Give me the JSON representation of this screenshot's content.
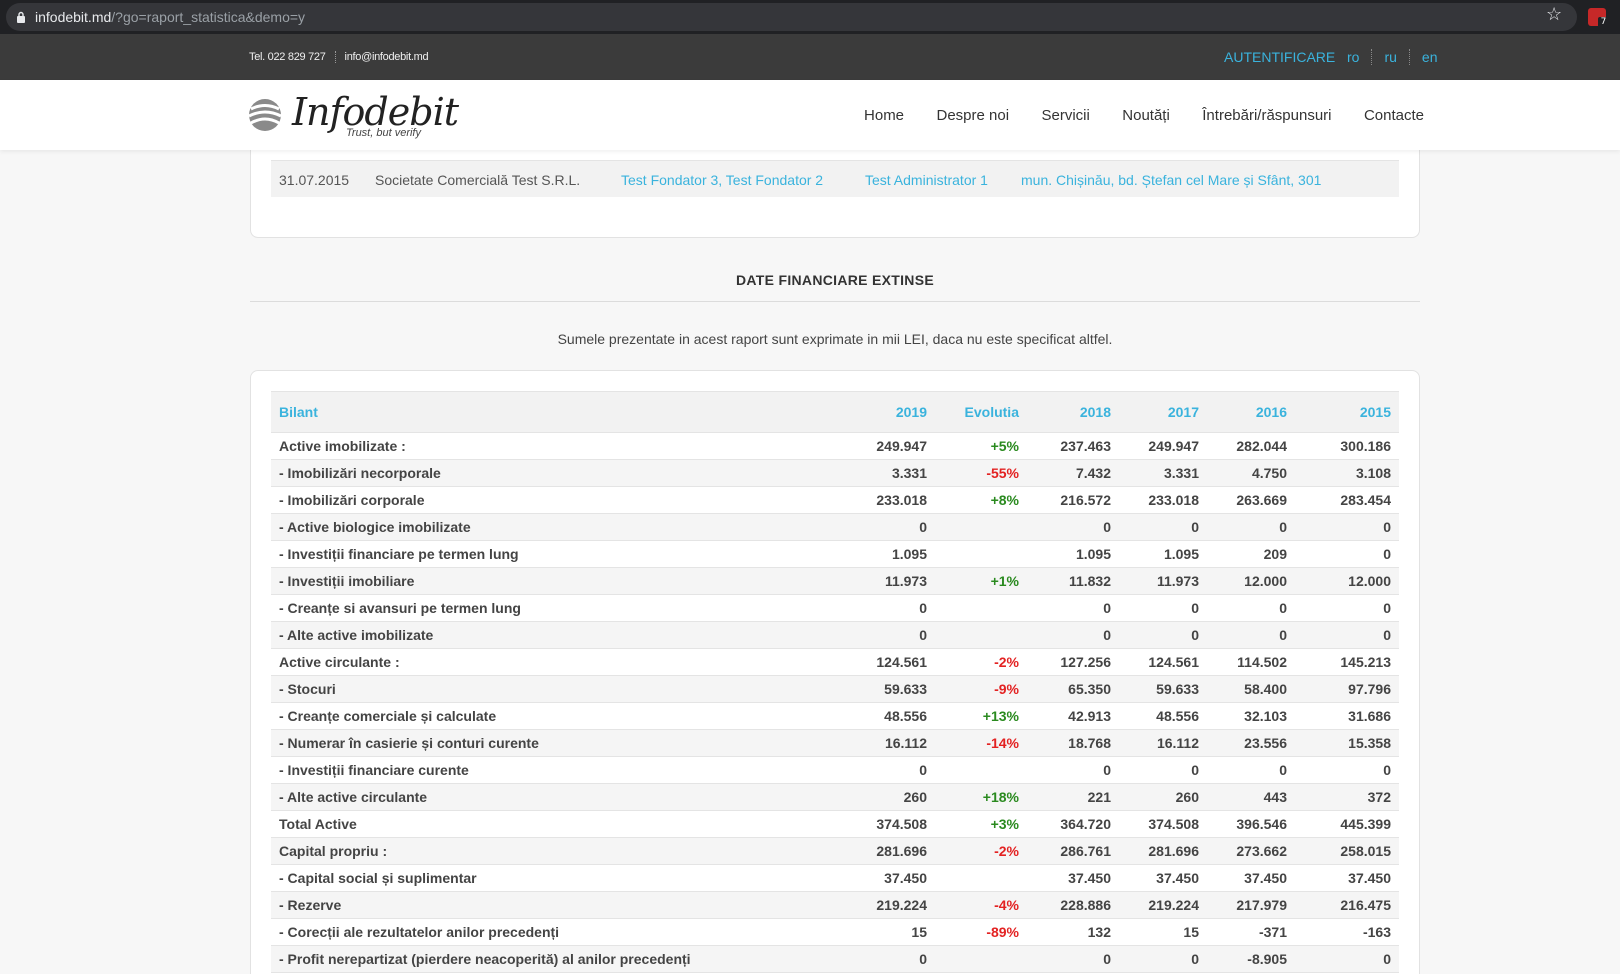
{
  "browser": {
    "url_host": "infodebit.md",
    "url_path": "/?go=raport_statistica&demo=y",
    "ext_badge": "7"
  },
  "topbar": {
    "phone": "Tel. 022 829 727",
    "email": "info@infodebit.md",
    "auth_label": "AUTENTIFICARE",
    "languages": [
      "ro",
      "ru",
      "en"
    ]
  },
  "brand": {
    "name": "Infodebit",
    "tagline": "Trust, but verify"
  },
  "nav": [
    "Home",
    "Despre noi",
    "Servicii",
    "Noutăți",
    "Întrebări/răspunsuri",
    "Contacte"
  ],
  "history_row": {
    "date": "31.07.2015",
    "company": "Societate Comercială Test S.R.L.",
    "founders": "Test Fondator 3, Test Fondator 2",
    "admin": "Test Administrator 1",
    "address": "mun. Chișinău, bd. Ștefan cel Mare și Sfânt, 301"
  },
  "section": {
    "title": "DATE FINANCIARE EXTINSE",
    "note": "Sumele prezentate in acest raport sunt exprimate in mii LEI, daca nu este specificat altfel."
  },
  "table": {
    "headers": [
      "Bilant",
      "2019",
      "Evolutia",
      "2018",
      "2017",
      "2016",
      "2015"
    ],
    "rows": [
      {
        "label": "Active imobilizate :",
        "v2019": "249.947",
        "evo": "+5%",
        "trend": "pos",
        "v2018": "237.463",
        "v2017": "249.947",
        "v2016": "282.044",
        "v2015": "300.186"
      },
      {
        "label": "- Imobilizări necorporale",
        "v2019": "3.331",
        "evo": "-55%",
        "trend": "neg",
        "v2018": "7.432",
        "v2017": "3.331",
        "v2016": "4.750",
        "v2015": "3.108"
      },
      {
        "label": "- Imobilizări corporale",
        "v2019": "233.018",
        "evo": "+8%",
        "trend": "pos",
        "v2018": "216.572",
        "v2017": "233.018",
        "v2016": "263.669",
        "v2015": "283.454"
      },
      {
        "label": "- Active biologice imobilizate",
        "v2019": "0",
        "evo": "",
        "trend": "",
        "v2018": "0",
        "v2017": "0",
        "v2016": "0",
        "v2015": "0"
      },
      {
        "label": "- Investiții financiare pe termen lung",
        "v2019": "1.095",
        "evo": "",
        "trend": "",
        "v2018": "1.095",
        "v2017": "1.095",
        "v2016": "209",
        "v2015": "0"
      },
      {
        "label": "- Investiții imobiliare",
        "v2019": "11.973",
        "evo": "+1%",
        "trend": "pos",
        "v2018": "11.832",
        "v2017": "11.973",
        "v2016": "12.000",
        "v2015": "12.000"
      },
      {
        "label": "- Creanțe si avansuri pe termen lung",
        "v2019": "0",
        "evo": "",
        "trend": "",
        "v2018": "0",
        "v2017": "0",
        "v2016": "0",
        "v2015": "0"
      },
      {
        "label": "- Alte active imobilizate",
        "v2019": "0",
        "evo": "",
        "trend": "",
        "v2018": "0",
        "v2017": "0",
        "v2016": "0",
        "v2015": "0"
      },
      {
        "label": "Active circulante :",
        "v2019": "124.561",
        "evo": "-2%",
        "trend": "neg",
        "v2018": "127.256",
        "v2017": "124.561",
        "v2016": "114.502",
        "v2015": "145.213"
      },
      {
        "label": "- Stocuri",
        "v2019": "59.633",
        "evo": "-9%",
        "trend": "neg",
        "v2018": "65.350",
        "v2017": "59.633",
        "v2016": "58.400",
        "v2015": "97.796"
      },
      {
        "label": "- Creanțe comerciale și calculate",
        "v2019": "48.556",
        "evo": "+13%",
        "trend": "pos",
        "v2018": "42.913",
        "v2017": "48.556",
        "v2016": "32.103",
        "v2015": "31.686"
      },
      {
        "label": "- Numerar în casierie și conturi curente",
        "v2019": "16.112",
        "evo": "-14%",
        "trend": "neg",
        "v2018": "18.768",
        "v2017": "16.112",
        "v2016": "23.556",
        "v2015": "15.358"
      },
      {
        "label": "- Investiții financiare curente",
        "v2019": "0",
        "evo": "",
        "trend": "",
        "v2018": "0",
        "v2017": "0",
        "v2016": "0",
        "v2015": "0"
      },
      {
        "label": "- Alte active circulante",
        "v2019": "260",
        "evo": "+18%",
        "trend": "pos",
        "v2018": "221",
        "v2017": "260",
        "v2016": "443",
        "v2015": "372"
      },
      {
        "label": "Total Active",
        "v2019": "374.508",
        "evo": "+3%",
        "trend": "pos",
        "v2018": "364.720",
        "v2017": "374.508",
        "v2016": "396.546",
        "v2015": "445.399"
      },
      {
        "label": "Capital propriu :",
        "v2019": "281.696",
        "evo": "-2%",
        "trend": "neg",
        "v2018": "286.761",
        "v2017": "281.696",
        "v2016": "273.662",
        "v2015": "258.015"
      },
      {
        "label": "- Capital social și suplimentar",
        "v2019": "37.450",
        "evo": "",
        "trend": "",
        "v2018": "37.450",
        "v2017": "37.450",
        "v2016": "37.450",
        "v2015": "37.450"
      },
      {
        "label": "- Rezerve",
        "v2019": "219.224",
        "evo": "-4%",
        "trend": "neg",
        "v2018": "228.886",
        "v2017": "219.224",
        "v2016": "217.979",
        "v2015": "216.475"
      },
      {
        "label": "- Corecții ale rezultatelor anilor precedenți",
        "v2019": "15",
        "evo": "-89%",
        "trend": "neg",
        "v2018": "132",
        "v2017": "15",
        "v2016": "-371",
        "v2015": "-163"
      },
      {
        "label": "- Profit nerepartizat (pierdere neacoperită) al anilor precedenți",
        "v2019": "0",
        "evo": "",
        "trend": "",
        "v2018": "0",
        "v2017": "0",
        "v2016": "-8.905",
        "v2015": "0"
      }
    ]
  }
}
